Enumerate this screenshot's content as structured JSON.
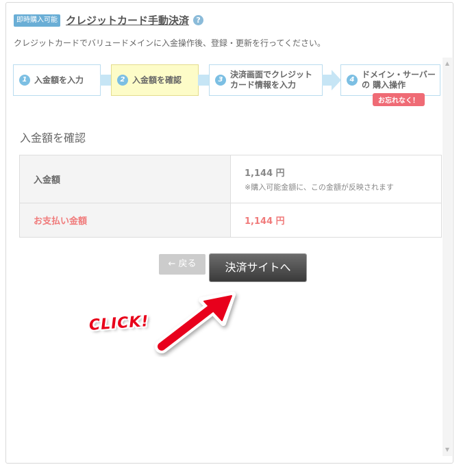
{
  "header": {
    "badge": "即時購入可能",
    "title": "クレジットカード手動決済",
    "help_icon": "question-circle-icon"
  },
  "description": "クレジットカードでバリュードメインに入金操作後、登録・更新を行ってください。",
  "steps": [
    {
      "number": "1",
      "label": "入金額を入力",
      "active": false
    },
    {
      "number": "2",
      "label": "入金額を確認",
      "active": true
    },
    {
      "number": "3",
      "label": "決済画面でクレジット カード情報を入力",
      "active": false
    },
    {
      "number": "4",
      "label": "ドメイン・サーバーの 購入操作",
      "active": false
    }
  ],
  "step_notice": "お忘れなく！",
  "section_title": "入金額を確認",
  "table": [
    {
      "label": "入金額",
      "value": "1,144 円",
      "note": "※購入可能金額に、この金額が反映されます"
    },
    {
      "label": "お支払い金額",
      "value": "1,144 円"
    }
  ],
  "buttons": {
    "back": "← 戻る",
    "pay": "決済サイトへ"
  },
  "annotation": {
    "text": "CLICK!",
    "arrow_color": "#e8001a"
  },
  "colors": {
    "accent_blue": "#6aaed6",
    "active_step": "#fdfcc8",
    "payment_red": "#f07b7b",
    "notice_red": "#ef6b75"
  }
}
